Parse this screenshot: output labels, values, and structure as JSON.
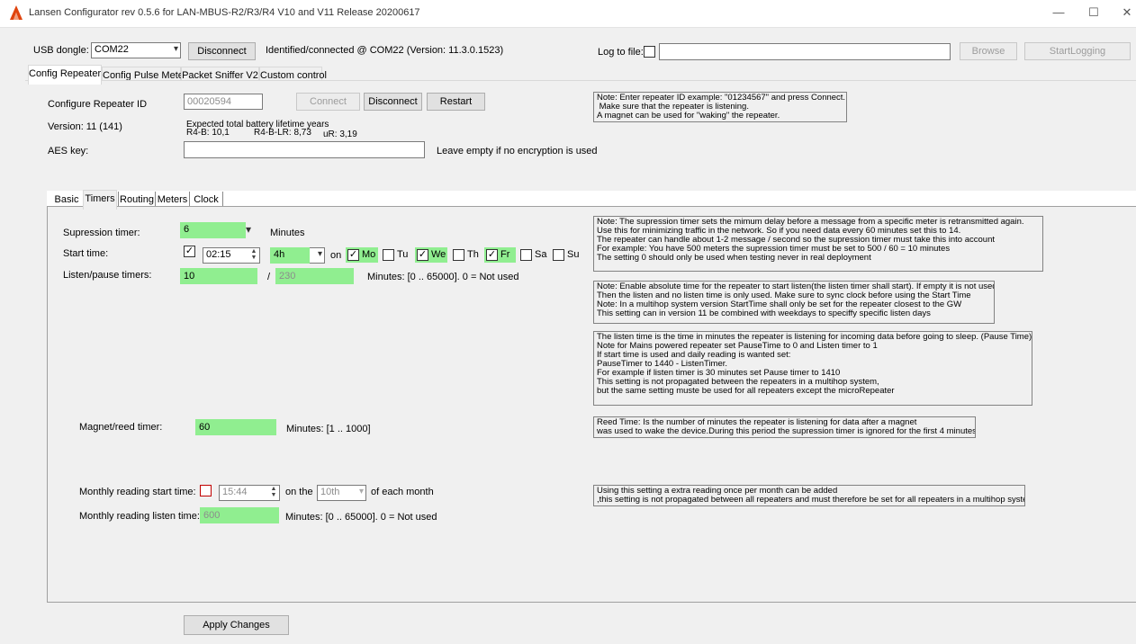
{
  "window": {
    "title": "Lansen Configurator rev 0.5.6 for LAN-MBUS-R2/R3/R4 V10 and V11  Release 20200617",
    "minimize": "—",
    "maximize": "☐",
    "close": "✕"
  },
  "toolbar": {
    "usb_label": "USB dongle:",
    "usb_value": "COM22",
    "disconnect_label": "Disconnect",
    "status": "Identified/connected @ COM22 (Version: 11.3.0.1523)",
    "log_label": "Log to file:",
    "browse_label": "Browse",
    "startlogging_label": "StartLogging"
  },
  "main_tabs": [
    "Config Repeater",
    "Config Pulse Meter",
    "Packet Sniffer V2",
    "Custom control"
  ],
  "repeater": {
    "configure_label": "Configure Repeater ID",
    "id_value": "00020594",
    "connect_label": "Connect",
    "disconnect_label": "Disconnect",
    "restart_label": "Restart",
    "version": "Version: 11 (141)",
    "battery_title": "Expected total battery lifetime years",
    "battery_r4b": "R4-B: 10,1",
    "battery_r4blr": "R4-B-LR: 8,73",
    "battery_ur": "uR: 3,19",
    "aes_label": "AES key:",
    "aes_value": "",
    "aes_hint": "Leave empty if no encryption is used",
    "note": "Note: Enter repeater ID example: \"01234567\" and press Connect.\n Make sure that the repeater is listening.\nA magnet can be used for \"waking\" the repeater."
  },
  "inner_tabs": [
    "Basic",
    "Timers",
    "Routing",
    "Meters",
    "Clock"
  ],
  "timers": {
    "supression_label": "Supression timer:",
    "supression_value": "6",
    "supression_unit": "Minutes",
    "start_label": "Start time:",
    "start_time": "02:15",
    "start_interval": "4h",
    "on_label": "on",
    "days": [
      {
        "label": "Mo",
        "checked": true
      },
      {
        "label": "Tu",
        "checked": false
      },
      {
        "label": "We",
        "checked": true
      },
      {
        "label": "Th",
        "checked": false
      },
      {
        "label": "Fr",
        "checked": true
      },
      {
        "label": "Sa",
        "checked": false
      },
      {
        "label": "Su",
        "checked": false
      }
    ],
    "listen_label": "Listen/pause timers:",
    "listen_value": "10",
    "slash": "/",
    "pause_value": "230",
    "listen_hint": "Minutes: [0 .. 65000]. 0 = Not used",
    "magnet_label": "Magnet/reed timer:",
    "magnet_value": "60",
    "magnet_hint": "Minutes: [1 .. 1000]",
    "monthly_start_label": "Monthly reading start time:",
    "monthly_time": "15:44",
    "on_the_label": "on the",
    "monthly_day": "10th",
    "of_each_month": "of each month",
    "monthly_listen_label": "Monthly reading listen time:",
    "monthly_listen_value": "600",
    "monthly_listen_hint": "Minutes: [0 .. 65000]. 0 = Not used",
    "note1": "Note: The supression timer sets the mimum delay before a message from a specific meter is retransmitted again.\nUse this for minimizing traffic in the network. So if you need data every 60 minutes set this to 14.\nThe repeater can handle about 1-2 message / second so the supression timer must take this into account\nFor example: You have 500 meters the supression timer must be set to 500 / 60 = 10 minutes\nThe setting 0 should only be used when testing never in real deployment",
    "note2": "Note: Enable absolute time for the repeater to start listen(the listen timer shall start). If empty it is not used\nThen the listen and no listen time is only used. Make sure to sync clock before using the Start Time\nNote: In a multihop system version StartTime shall only be set for the repeater closest to the GW\nThis setting can in version 11 be combined with weekdays to speciffy specific listen days",
    "note3": "The listen time is the time in minutes the repeater is listening for incoming data before going to sleep. (Pause Time).\nNote for Mains powered repeater set PauseTime to 0 and Listen timer to 1\nIf start time is used and daily reading is wanted set:\nPauseTimer to 1440 - ListenTimer.\nFor example if listen timer is 30 minutes set Pause timer to 1410\nThis setting is not propagated between the repeaters in a multihop system,\nbut the same setting muste be used for all repeaters except the microRepeater",
    "note4": "Reed Time: Is the number of minutes the repeater is listening for data after a magnet\nwas used to wake the device.During this period the supression timer is ignored for the first 4 minutes",
    "note5": "Using this setting a extra reading once per month can be added\n,this setting is not propagated between all repeaters and must therefore be set for all repeaters in a multihop system"
  },
  "apply_label": "Apply Changes",
  "colors": {
    "field_green": "#90ee90",
    "accent": "#e0440e"
  }
}
